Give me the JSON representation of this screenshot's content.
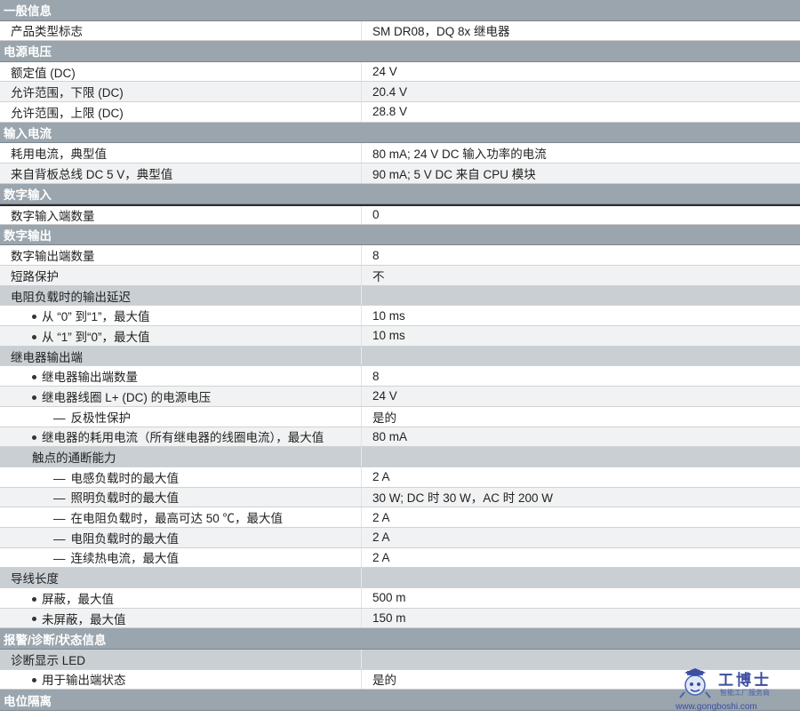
{
  "rows": [
    {
      "type": "section",
      "label": "一般信息"
    },
    {
      "type": "item",
      "indent": 0,
      "mark": "none",
      "label": "产品类型标志",
      "value": "SM DR08，DQ 8x 继电器"
    },
    {
      "type": "section",
      "label": "电源电压"
    },
    {
      "type": "item",
      "indent": 0,
      "mark": "none",
      "label": "额定值 (DC)",
      "value": "24 V"
    },
    {
      "type": "item",
      "indent": 0,
      "mark": "none",
      "label": "允许范围，下限 (DC)",
      "value": "20.4 V"
    },
    {
      "type": "item",
      "indent": 0,
      "mark": "none",
      "label": "允许范围，上限 (DC)",
      "value": "28.8 V"
    },
    {
      "type": "section",
      "label": "输入电流"
    },
    {
      "type": "item",
      "indent": 0,
      "mark": "none",
      "label": "耗用电流，典型值",
      "value": "80 mA; 24 V DC 输入功率的电流"
    },
    {
      "type": "item",
      "indent": 0,
      "mark": "none",
      "label": "来自背板总线 DC 5 V，典型值",
      "value": "90 mA; 5 V DC 来自 CPU 模块"
    },
    {
      "type": "section",
      "label": "数字输入"
    },
    {
      "type": "item",
      "indent": 0,
      "mark": "none",
      "label": "数字输入端数量",
      "value": "0",
      "boxed": true
    },
    {
      "type": "section",
      "label": "数字输出"
    },
    {
      "type": "item",
      "indent": 0,
      "mark": "none",
      "label": "数字输出端数量",
      "value": "8"
    },
    {
      "type": "item",
      "indent": 0,
      "mark": "none",
      "label": "短路保护",
      "value": "不"
    },
    {
      "type": "sub",
      "indent": 0,
      "label": "电阻负载时的输出延迟"
    },
    {
      "type": "item",
      "indent": 1,
      "mark": "bullet",
      "label": "从 “0” 到“1”，最大值",
      "value": "10 ms"
    },
    {
      "type": "item",
      "indent": 1,
      "mark": "bullet",
      "label": "从 “1” 到“0”，最大值",
      "value": "10 ms"
    },
    {
      "type": "sub",
      "indent": 0,
      "label": "继电器输出端"
    },
    {
      "type": "item",
      "indent": 1,
      "mark": "bullet",
      "label": "继电器输出端数量",
      "value": "8"
    },
    {
      "type": "item",
      "indent": 1,
      "mark": "bullet",
      "label": "继电器线圈 L+ (DC) 的电源电压",
      "value": "24 V"
    },
    {
      "type": "item",
      "indent": 2,
      "mark": "dash",
      "label": "反极性保护",
      "value": "是的"
    },
    {
      "type": "item",
      "indent": 1,
      "mark": "bullet",
      "label": "继电器的耗用电流（所有继电器的线圈电流），最大值",
      "value": "80 mA"
    },
    {
      "type": "sub",
      "indent": 1,
      "label": "触点的通断能力"
    },
    {
      "type": "item",
      "indent": 2,
      "mark": "dash",
      "label": "电感负载时的最大值",
      "value": "2 A"
    },
    {
      "type": "item",
      "indent": 2,
      "mark": "dash",
      "label": "照明负载时的最大值",
      "value": "30 W; DC 时 30 W，AC 时 200 W"
    },
    {
      "type": "item",
      "indent": 2,
      "mark": "dash",
      "label": "在电阻负载时，最高可达 50 ℃，最大值",
      "value": "2 A"
    },
    {
      "type": "item",
      "indent": 2,
      "mark": "dash",
      "label": "电阻负载时的最大值",
      "value": "2 A"
    },
    {
      "type": "item",
      "indent": 2,
      "mark": "dash",
      "label": "连续热电流，最大值",
      "value": "2 A"
    },
    {
      "type": "sub",
      "indent": 0,
      "label": "导线长度"
    },
    {
      "type": "item",
      "indent": 1,
      "mark": "bullet",
      "label": "屏蔽，最大值",
      "value": "500 m"
    },
    {
      "type": "item",
      "indent": 1,
      "mark": "bullet",
      "label": "未屏蔽，最大值",
      "value": "150 m"
    },
    {
      "type": "section",
      "label": "报警/诊断/状态信息"
    },
    {
      "type": "sub",
      "indent": 0,
      "label": "诊断显示 LED"
    },
    {
      "type": "item",
      "indent": 1,
      "mark": "bullet",
      "label": "用于输出端状态",
      "value": "是的"
    },
    {
      "type": "section",
      "label": "电位隔离"
    }
  ],
  "watermark": {
    "brand": "工博士",
    "tagline": "智能工厂服务商",
    "url": "www.gongboshi.com",
    "icon": "mascot-icon"
  },
  "colors": {
    "section_bg": "#9aa5ad",
    "sub_bg": "#c9cfd3",
    "alt_row_bg": "#f1f2f3",
    "watermark": "#3b4ea0"
  }
}
